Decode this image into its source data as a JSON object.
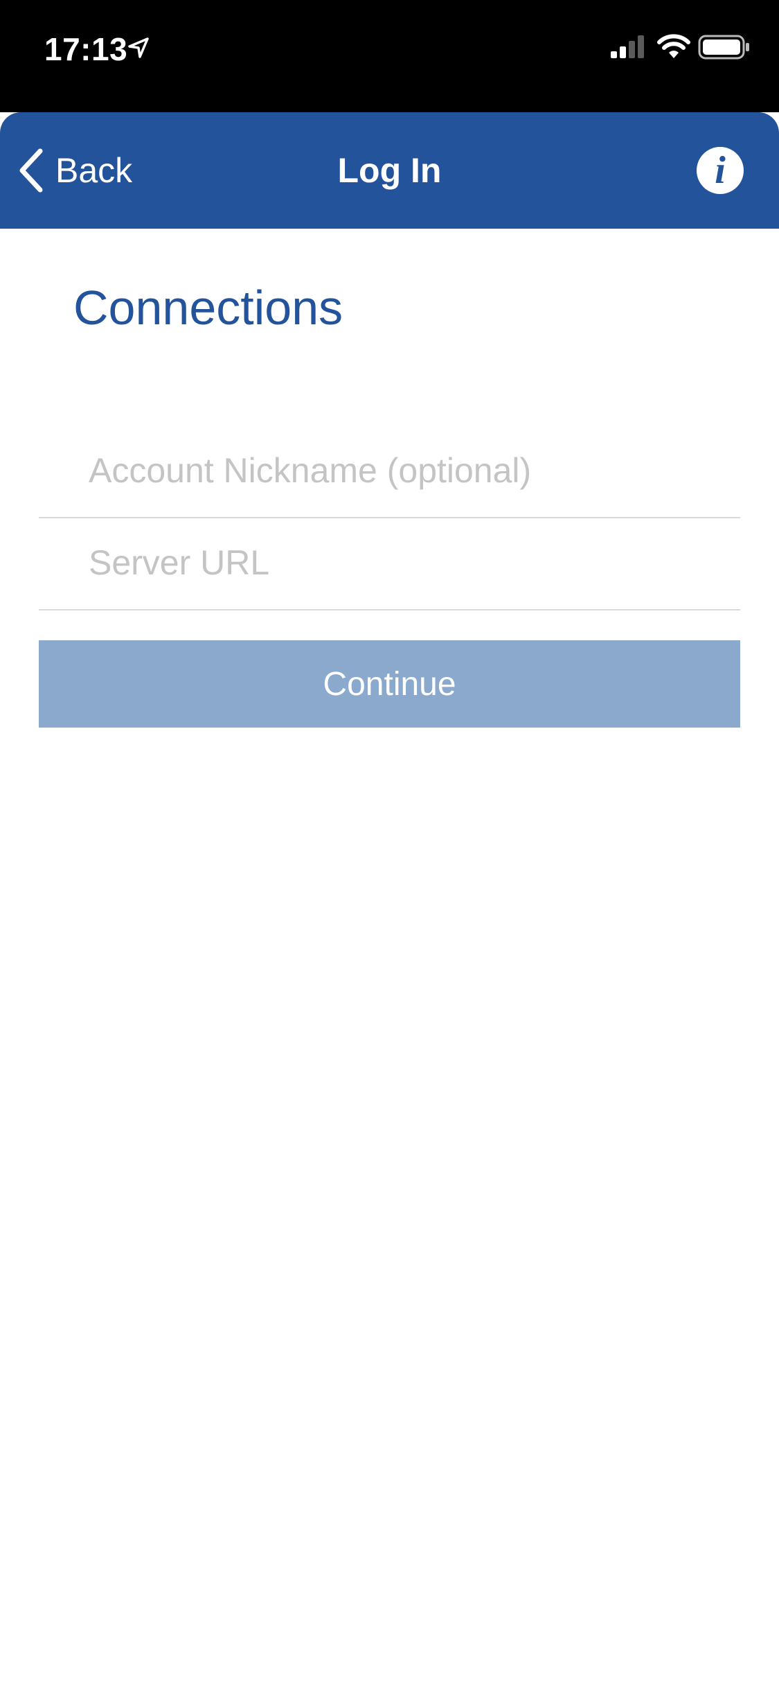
{
  "status_bar": {
    "time": "17:13",
    "icons": [
      "location-arrow-icon",
      "cellular-signal-icon",
      "wifi-icon",
      "battery-icon"
    ]
  },
  "nav": {
    "back_label": "Back",
    "title": "Log In",
    "info_icon": "info-icon",
    "info_glyph": "i",
    "background_color": "#23539b"
  },
  "main": {
    "section_title": "Connections",
    "fields": [
      {
        "name": "account-nickname",
        "placeholder": "Account Nickname (optional)",
        "value": ""
      },
      {
        "name": "server-url",
        "placeholder": "Server URL",
        "value": ""
      }
    ],
    "continue_label": "Continue",
    "continue_color": "#8aa9cd"
  }
}
